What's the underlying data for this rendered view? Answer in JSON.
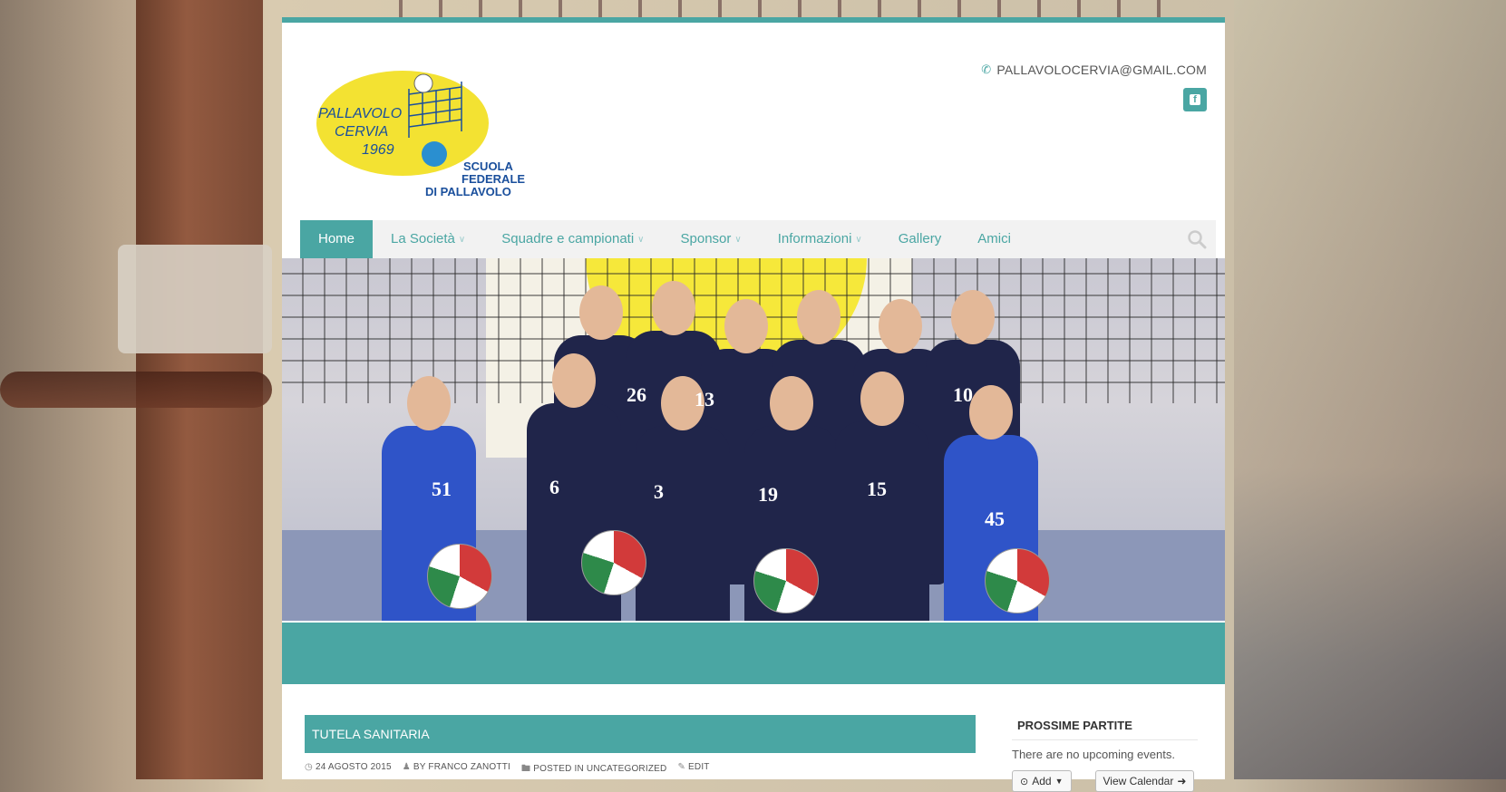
{
  "header": {
    "logo": {
      "line1": "PALLAVOLO",
      "line2": "CERVIA",
      "year": "1969",
      "school1": "SCUOLA",
      "school2": "FEDERALE",
      "school3": "DI PALLAVOLO"
    },
    "email": "PALLAVOLOCERVIA@GMAIL.COM",
    "facebook_icon": "facebook-icon"
  },
  "nav": {
    "items": [
      {
        "label": "Home",
        "active": true,
        "dropdown": false
      },
      {
        "label": "La Società",
        "active": false,
        "dropdown": true
      },
      {
        "label": "Squadre e campionati",
        "active": false,
        "dropdown": true
      },
      {
        "label": "Sponsor",
        "active": false,
        "dropdown": true
      },
      {
        "label": "Informazioni",
        "active": false,
        "dropdown": true
      },
      {
        "label": "Gallery",
        "active": false,
        "dropdown": false
      },
      {
        "label": "Amici",
        "active": false,
        "dropdown": false
      }
    ],
    "search_icon": "search-icon"
  },
  "hero": {
    "jersey_numbers": [
      "26",
      "13",
      "10",
      "51",
      "6",
      "3",
      "19",
      "15",
      "45"
    ]
  },
  "post": {
    "title": "TUTELA SANITARIA",
    "date": "24 AGOSTO 2015",
    "author": "BY FRANCO ZANOTTI",
    "category_prefix": "POSTED IN",
    "category": "UNCATEGORIZED",
    "edit": "EDIT"
  },
  "sidebar": {
    "widget_title": "PROSSIME PARTITE",
    "no_events": "There are no upcoming events.",
    "add_button": "Add",
    "view_calendar_button": "View Calendar"
  },
  "colors": {
    "accent": "#4aa6a3",
    "logo_yellow": "#f3e232",
    "logo_blue": "#1a4f9c"
  }
}
